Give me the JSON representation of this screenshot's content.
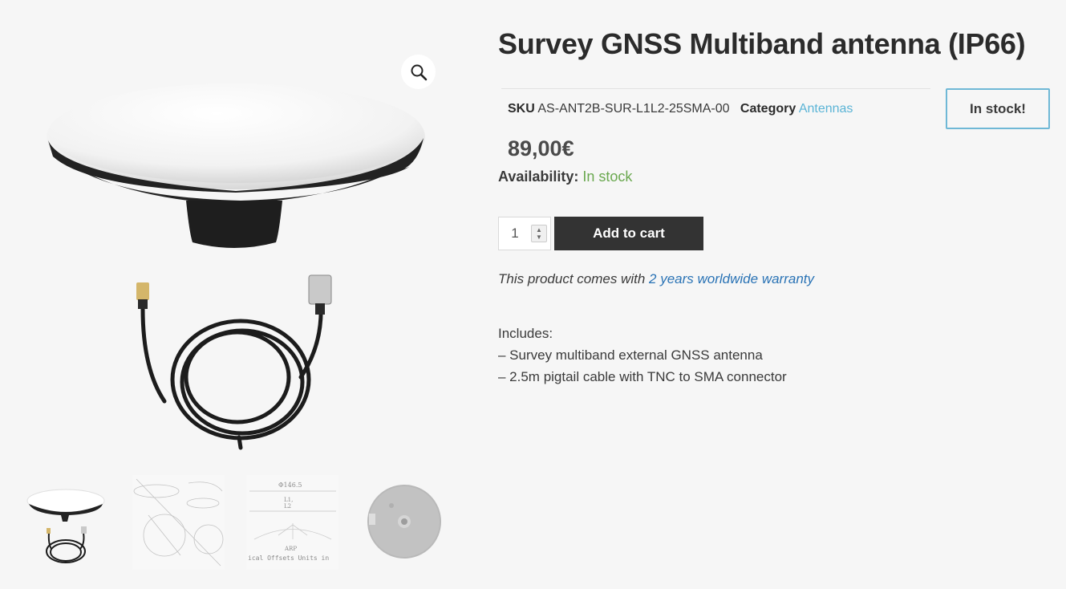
{
  "product": {
    "title": "Survey GNSS Multiband antenna (IP66)",
    "sku_label": "SKU",
    "sku_value": "AS-ANT2B-SUR-L1L2-25SMA-00",
    "category_label": "Category",
    "category_value": "Antennas",
    "stock_badge": "In stock!",
    "price": "89,00€",
    "availability_label": "Availability:",
    "availability_value": "In stock",
    "quantity": "1",
    "add_to_cart": "Add to cart",
    "warranty_prefix": "This product comes with",
    "warranty_link": "2 years worldwide warranty",
    "includes_title": "Includes:",
    "includes": [
      "– Survey multiband external GNSS antenna",
      "– 2.5m pigtail cable with TNC to SMA connector"
    ]
  },
  "gallery": {
    "zoom_icon": "magnifier-icon",
    "thumb_drawing_label_1": "Φ146.5",
    "thumb_drawing_label_2": "L1,",
    "thumb_drawing_label_3": "L2",
    "thumb_drawing_label_4": "ARP",
    "thumb_drawing_label_5": "ical Offsets Units in"
  },
  "colors": {
    "background": "#f6f6f6",
    "link": "#2a73b5",
    "category_link": "#5bb4d6",
    "in_stock": "#6aa84f",
    "badge_border": "#6fb8d6",
    "button": "#333333"
  }
}
